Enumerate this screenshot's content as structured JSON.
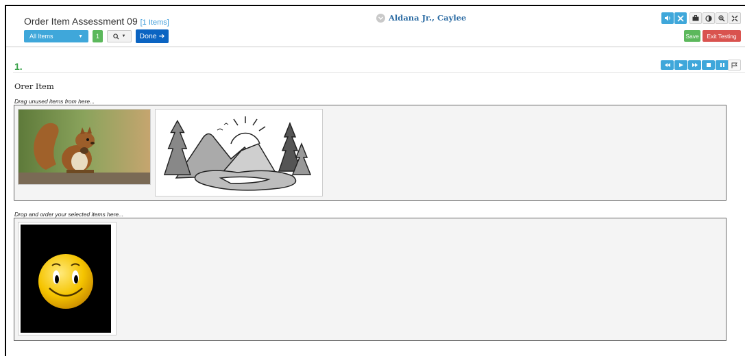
{
  "header": {
    "title": "Order Item Assessment 09",
    "item_count": "[1 Items]",
    "student_name": "Aldana Jr., Caylee",
    "items_dropdown": "All Items",
    "question_number_button": "1",
    "done_label": "Done",
    "save_label": "Save",
    "exit_label": "Exit Testing"
  },
  "toolbar": {
    "icons": [
      "speaker-icon",
      "eliminator-icon",
      "briefcase-icon",
      "contrast-icon",
      "zoom-icon",
      "fullscreen-icon"
    ]
  },
  "question": {
    "number": "1.",
    "stem": "Orer Item",
    "source_label": "Drag unused items from here...",
    "target_label": "Drop and order your selected items here...",
    "source_items": [
      "squirrel-image",
      "mountain-landscape-image"
    ],
    "selected_items": [
      "smiley-face-image"
    ]
  },
  "media_controls": [
    "rewind-icon",
    "play-icon",
    "fast-forward-icon",
    "stop-icon",
    "pause-icon"
  ],
  "colors": {
    "primary_blue": "#3fa7da",
    "done_blue": "#0b64c2",
    "success_green": "#5cb85c",
    "danger_red": "#d9534f",
    "question_number_green": "#3aa24a"
  }
}
